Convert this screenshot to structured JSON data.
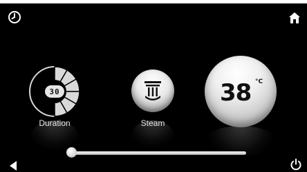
{
  "screen": {
    "background": "#000000"
  },
  "top_bar": {
    "left_icon": "clock-icon",
    "right_icon": "home-icon"
  },
  "bottom_bar": {
    "left_icon": "back-arrow-icon",
    "right_icon": "power-icon"
  },
  "controls": {
    "duration": {
      "value": "30",
      "label": "Duration",
      "icon": "duration-dial-icon"
    },
    "steam": {
      "label": "Steam",
      "icon": "steam-shower-icon"
    },
    "temperature": {
      "value": "38",
      "unit": "°C"
    }
  },
  "slider": {
    "level": 0.0
  }
}
